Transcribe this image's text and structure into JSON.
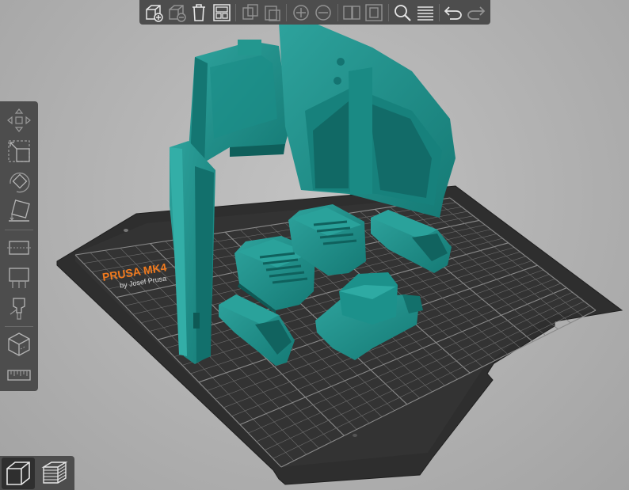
{
  "app": {
    "bed_logo_line1": "PRUSA MK4",
    "bed_logo_line2": "by Josef Prusa"
  },
  "colors": {
    "background": "#b4b4b4",
    "toolbar_bg": "#4d4d4d",
    "model": "#1f8b86",
    "model_dark": "#126a66",
    "model_light": "#33a7a1",
    "bed": "#2f2f2f",
    "bed_grid": "#6d6d6d",
    "bed_grid_major": "#8a8a8a",
    "brand_orange": "#f07a1e",
    "icon_light": "#e6e6e6"
  },
  "toolbar": {
    "buttons": [
      {
        "name": "add-object",
        "enabled": true
      },
      {
        "name": "delete",
        "enabled": false
      },
      {
        "name": "delete-all",
        "enabled": true
      },
      {
        "name": "arrange",
        "enabled": true
      },
      {
        "name": "copy",
        "enabled": false
      },
      {
        "name": "paste",
        "enabled": false
      },
      {
        "name": "add-instance",
        "enabled": false
      },
      {
        "name": "remove-instance",
        "enabled": false
      },
      {
        "name": "split-objects",
        "enabled": false
      },
      {
        "name": "split-parts",
        "enabled": false
      },
      {
        "name": "search",
        "enabled": true
      },
      {
        "name": "layers-editing",
        "enabled": true
      },
      {
        "name": "undo",
        "enabled": true
      },
      {
        "name": "redo",
        "enabled": false
      }
    ]
  },
  "left_toolbar": {
    "tools": [
      "move",
      "scale",
      "rotate",
      "place-on-face",
      "cut",
      "paint-supports",
      "seam-painting",
      "fdm-supports",
      "measure"
    ]
  },
  "view_tabs": {
    "active": "3d-view",
    "tabs": [
      "3d-view",
      "preview"
    ]
  }
}
